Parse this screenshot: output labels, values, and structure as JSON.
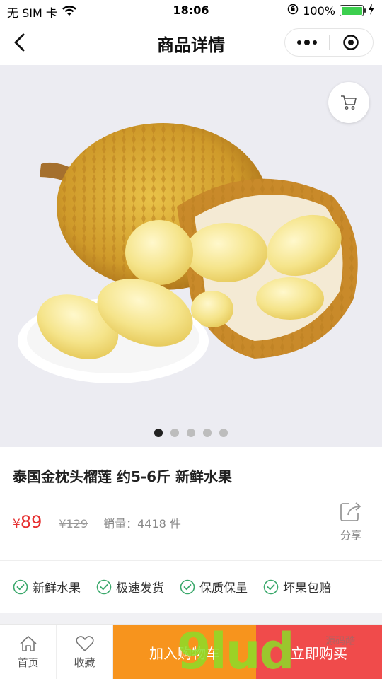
{
  "status_bar": {
    "carrier": "无 SIM 卡",
    "time": "18:06",
    "battery": "100%",
    "battery_level": 1.0
  },
  "nav": {
    "title": "商品详情"
  },
  "gallery": {
    "image_count": 5,
    "active_index": 0
  },
  "product": {
    "title": "泰国金枕头榴莲 约5-6斤 新鲜水果",
    "currency": "¥",
    "price": "89",
    "original_price": "¥129",
    "sales": "销量：4418 件",
    "share_label": "分享"
  },
  "features": [
    "新鲜水果",
    "极速发货",
    "保质保量",
    "坏果包赔"
  ],
  "bottom_bar": {
    "home_label": "首页",
    "favorite_label": "收藏",
    "add_cart_label": "加入购物车",
    "buy_now_label": "立即购买"
  },
  "watermark": {
    "text": "9lud",
    "sub": "源码酷"
  },
  "colors": {
    "accent_red": "#e63030",
    "add_cart_bg": "#f7941d",
    "buy_now_bg": "#f04b4b",
    "check_green": "#3aa86b",
    "gallery_bg": "#ececf2"
  }
}
